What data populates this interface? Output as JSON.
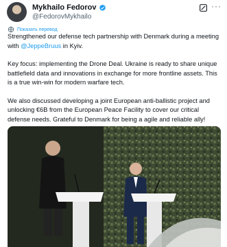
{
  "author": {
    "display_name": "Mykhailo Fedorov",
    "handle": "@FedorovMykhailo"
  },
  "icons": {
    "avatar": "profile-photo",
    "verified": "verified-badge-icon",
    "grok": "grok-icon",
    "more": "more-icon",
    "translate": "translate-icon"
  },
  "more_glyph": "···",
  "translate_label": "Показать перевод",
  "tweet": {
    "p1_before": "Strengthened our defense tech partnership with Denmark during a meeting with ",
    "p1_mention": "@JeppeBruus",
    "p1_after": " in Kyiv.",
    "p2": "Key focus: implementing the Drone Deal. Ukraine is ready to share unique battlefield data and innovations in exchange for more frontline assets. This is a true win-win for modern warfare tech.",
    "p3": "We also discussed developing a joint European anti-ballistic project and unlocking €6B from the European Peace Facility to cover our critical defense needs. Grateful to Denmark for being a agile and reliable ally!"
  },
  "colors": {
    "link": "#1d9bf0",
    "verified": "#1d9bf0",
    "text": "#0f1419",
    "secondary": "#536471"
  }
}
